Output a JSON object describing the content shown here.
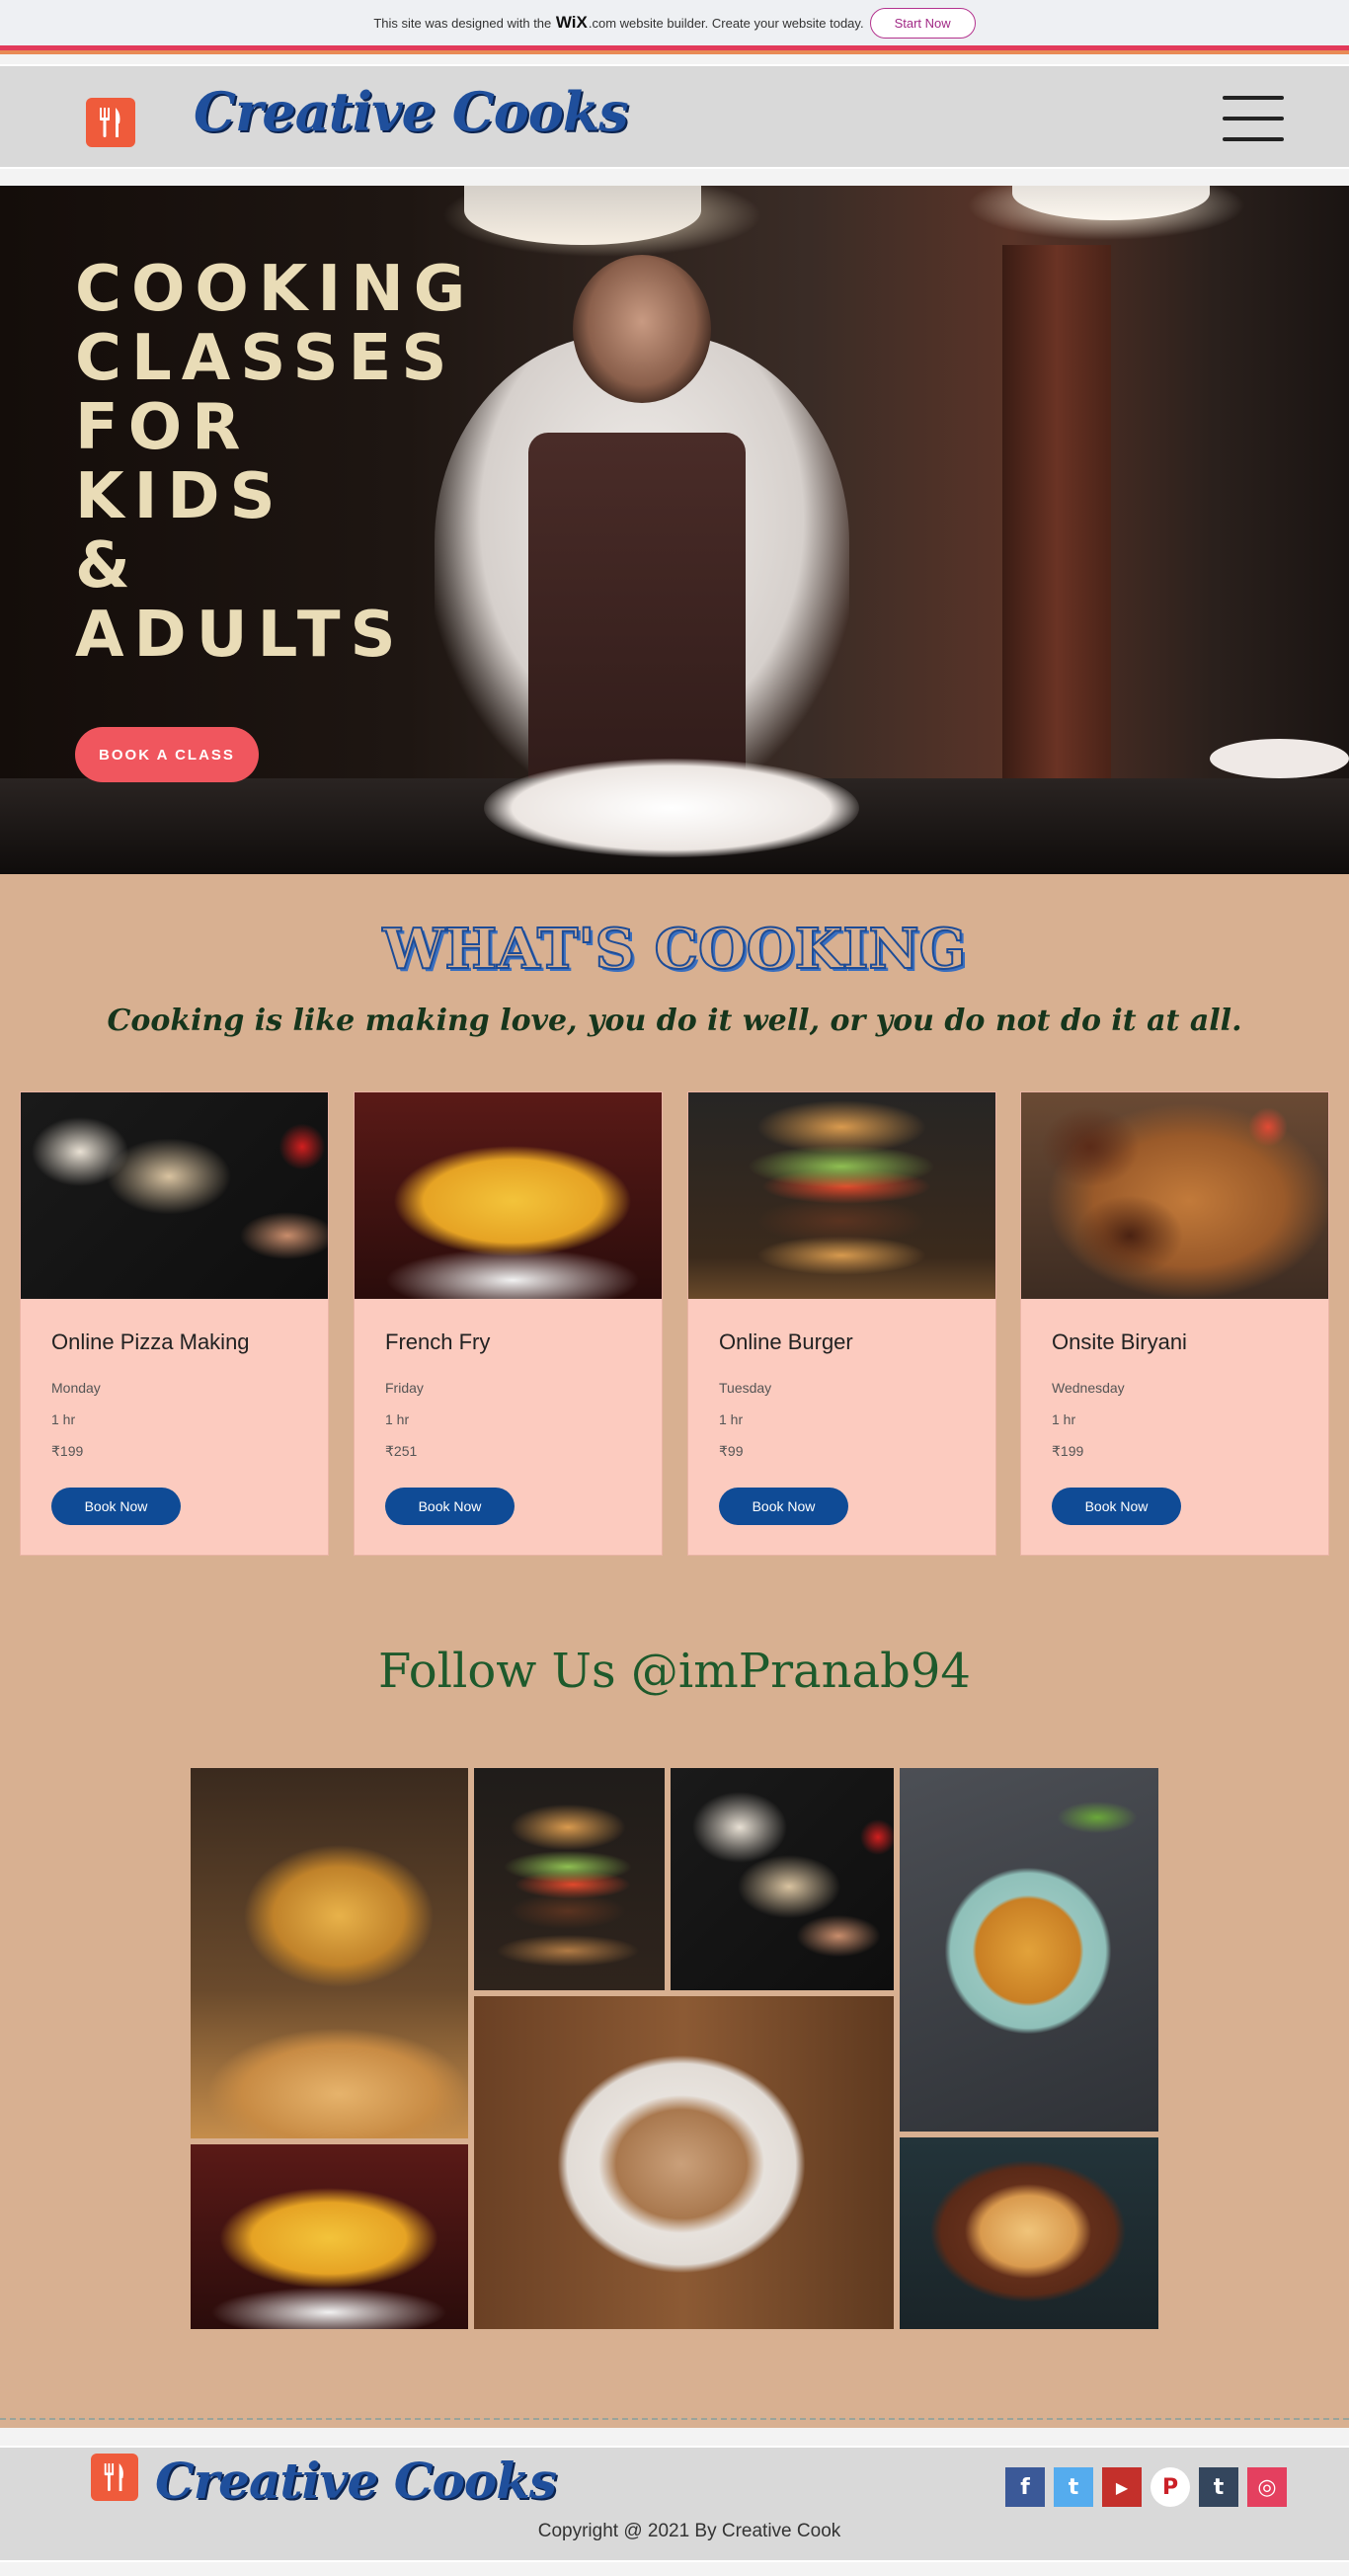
{
  "wix_banner": {
    "text_before": "This site was designed with the",
    "wix_logo": "WiX",
    "text_after": ".com website builder. Create your website today.",
    "cta": "Start Now"
  },
  "header": {
    "brand": "Creative Cooks",
    "logo_icon": "fork-knife-icon",
    "menu_icon": "hamburger-menu-icon"
  },
  "hero": {
    "title_lines": [
      "COOKING",
      "CLASSES",
      "FOR",
      "KIDS",
      "&",
      "ADULTS"
    ],
    "cta": "BOOK A CLASS"
  },
  "cooking": {
    "title": "WHAT'S COOKING",
    "quote": "Cooking is like making love, you do it well, or you do not do it at all.",
    "cards": [
      {
        "name": "Online Pizza Making",
        "day": "Monday",
        "duration": "1 hr",
        "price": "₹199",
        "button": "Book Now",
        "image": "pizza"
      },
      {
        "name": "French Fry",
        "day": "Friday",
        "duration": "1 hr",
        "price": "₹251",
        "button": "Book Now",
        "image": "fries"
      },
      {
        "name": "Online Burger",
        "day": "Tuesday",
        "duration": "1 hr",
        "price": "₹99",
        "button": "Book Now",
        "image": "burger"
      },
      {
        "name": "Onsite Biryani",
        "day": "Wednesday",
        "duration": "1 hr",
        "price": "₹199",
        "button": "Book Now",
        "image": "biryani"
      }
    ]
  },
  "follow": {
    "title": "Follow Us @imPranab94"
  },
  "footer": {
    "brand": "Creative Cooks",
    "copyright": "Copyright @ 2021 By  Creative Cook",
    "social": [
      {
        "name": "facebook-icon",
        "glyph": "f",
        "color": "#3b5998"
      },
      {
        "name": "twitter-icon",
        "glyph": "t",
        "color": "#55acee"
      },
      {
        "name": "youtube-icon",
        "glyph": "▶",
        "color": "#c4302b"
      },
      {
        "name": "pinterest-icon",
        "glyph": "P",
        "color": "#cb2027"
      },
      {
        "name": "tumblr-icon",
        "glyph": "t",
        "color": "#34465d"
      },
      {
        "name": "instagram-icon",
        "glyph": "◎",
        "color": "#e4405f"
      }
    ]
  },
  "colors": {
    "brand_blue": "#1f4f9c",
    "button_blue": "#0f4b96",
    "hero_button": "#f0565e",
    "page_bg": "#d8b091",
    "card_bg": "#fccbbf",
    "follow_green": "#1e5a2c"
  }
}
